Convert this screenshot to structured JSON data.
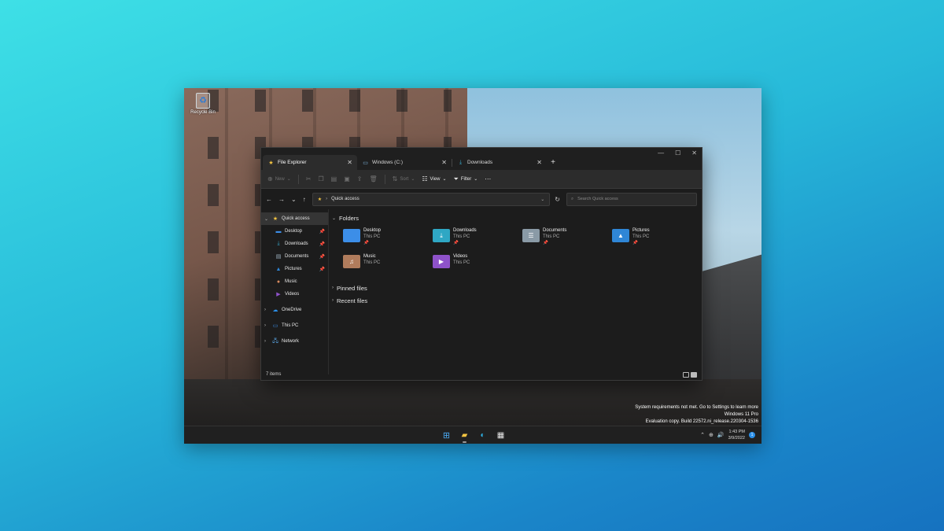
{
  "desktop": {
    "recycle_bin_label": "Recycle Bin",
    "watermark_lines": [
      "System requirements not met. Go to Settings to learn more",
      "Windows 11 Pro",
      "Evaluation copy. Build 22572.ni_release.220304-1536"
    ]
  },
  "explorer": {
    "tabs": [
      {
        "label": "File Explorer",
        "icon": "star-icon",
        "active": true
      },
      {
        "label": "Windows (C:)",
        "icon": "drive-icon",
        "active": false
      },
      {
        "label": "Downloads",
        "icon": "download-icon",
        "active": false
      }
    ],
    "toolbar": {
      "new_label": "New",
      "sort_label": "Sort",
      "view_label": "View",
      "filter_label": "Filter"
    },
    "address": {
      "path": "Quick access",
      "search_placeholder": "Search Quick access"
    },
    "nav_pane": {
      "quick_access": "Quick access",
      "quick_items": [
        {
          "label": "Desktop",
          "icon": "desktop-icon",
          "pinned": true
        },
        {
          "label": "Downloads",
          "icon": "download-icon",
          "pinned": true
        },
        {
          "label": "Documents",
          "icon": "document-icon",
          "pinned": true
        },
        {
          "label": "Pictures",
          "icon": "picture-icon",
          "pinned": true
        },
        {
          "label": "Music",
          "icon": "music-icon",
          "pinned": false
        },
        {
          "label": "Videos",
          "icon": "video-icon",
          "pinned": false
        }
      ],
      "roots": [
        {
          "label": "OneDrive",
          "icon": "cloud-icon"
        },
        {
          "label": "This PC",
          "icon": "monitor-icon"
        },
        {
          "label": "Network",
          "icon": "network-icon"
        }
      ]
    },
    "content": {
      "folders_heading": "Folders",
      "folders": [
        {
          "name": "Desktop",
          "location": "This PC",
          "pinned": true,
          "color": "#3c8ee8",
          "glyph": ""
        },
        {
          "name": "Downloads",
          "location": "This PC",
          "pinned": true,
          "color": "#2fa7c4",
          "glyph": "⤓"
        },
        {
          "name": "Documents",
          "location": "This PC",
          "pinned": true,
          "color": "#8a9aa6",
          "glyph": "☰"
        },
        {
          "name": "Pictures",
          "location": "This PC",
          "pinned": true,
          "color": "#2f86d6",
          "glyph": "▲"
        },
        {
          "name": "Music",
          "location": "This PC",
          "pinned": false,
          "color": "#b07c5c",
          "glyph": "♫"
        },
        {
          "name": "Videos",
          "location": "This PC",
          "pinned": false,
          "color": "#8e52c9",
          "glyph": "▶"
        }
      ],
      "pinned_heading": "Pinned files",
      "recent_heading": "Recent files"
    },
    "status": {
      "items_text": "7 items"
    }
  },
  "taskbar": {
    "time": "1:43 PM",
    "date": "3/9/2022",
    "notification_count": "1"
  }
}
